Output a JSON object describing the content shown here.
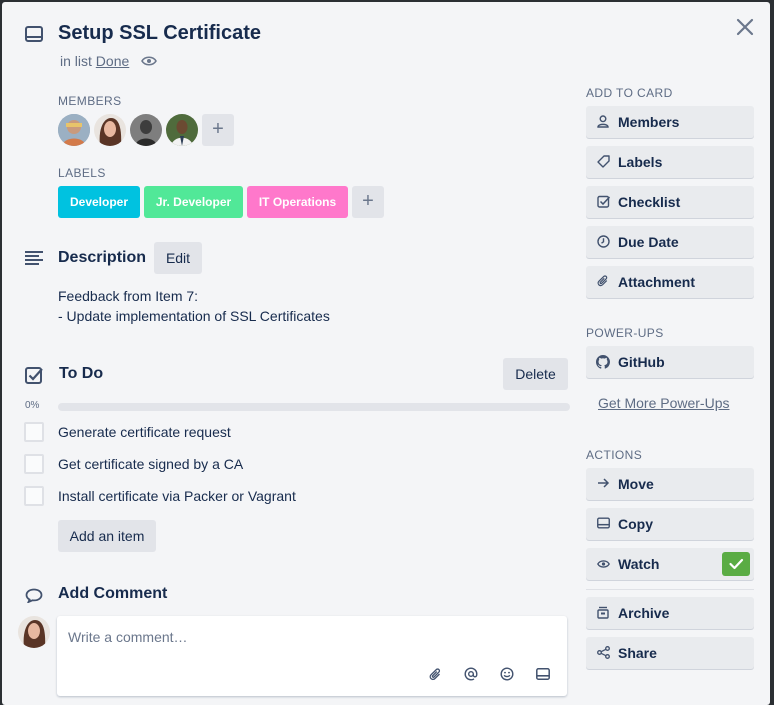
{
  "card": {
    "title": "Setup SSL Certificate",
    "in_list_prefix": "in list",
    "list_name": "Done"
  },
  "members": {
    "label": "MEMBERS",
    "avatars": [
      "member-1",
      "member-2",
      "member-3",
      "member-4"
    ],
    "add": "+"
  },
  "labels": {
    "label": "LABELS",
    "items": [
      {
        "text": "Developer",
        "color": "#00c2e0"
      },
      {
        "text": "Jr. Developer",
        "color": "#51e898"
      },
      {
        "text": "IT Operations",
        "color": "#ff78cb"
      }
    ],
    "add": "+"
  },
  "description": {
    "heading": "Description",
    "edit_label": "Edit",
    "line1": "Feedback from Item 7:",
    "line2": "- Update implementation of SSL Certificates"
  },
  "checklist": {
    "heading": "To Do",
    "delete_label": "Delete",
    "progress_text": "0%",
    "progress": 0,
    "items": [
      {
        "text": "Generate certificate request",
        "checked": false
      },
      {
        "text": "Get certificate signed by a CA",
        "checked": false
      },
      {
        "text": "Install certificate via Packer or Vagrant",
        "checked": false
      }
    ],
    "add_item_label": "Add an item"
  },
  "comment": {
    "heading": "Add Comment",
    "placeholder": "Write a comment…"
  },
  "sidebar": {
    "add_to_card_label": "ADD TO CARD",
    "add_to_card": [
      {
        "label": "Members",
        "icon": "person-icon"
      },
      {
        "label": "Labels",
        "icon": "tag-icon"
      },
      {
        "label": "Checklist",
        "icon": "checkbox-icon"
      },
      {
        "label": "Due Date",
        "icon": "clock-icon"
      },
      {
        "label": "Attachment",
        "icon": "paperclip-icon"
      }
    ],
    "powerups_label": "POWER-UPS",
    "github_label": "GitHub",
    "more_powerups": "Get More Power-Ups",
    "actions_label": "ACTIONS",
    "actions": [
      {
        "label": "Move",
        "icon": "arrow-right-icon"
      },
      {
        "label": "Copy",
        "icon": "card-icon"
      },
      {
        "label": "Watch",
        "icon": "eye-icon",
        "active": true
      },
      {
        "label": "Archive",
        "icon": "archive-icon"
      },
      {
        "label": "Share",
        "icon": "share-icon"
      }
    ],
    "watch_check_color": "#5aac44"
  },
  "colors": {
    "background": "#f4f5f7",
    "text": "#172b4d",
    "muted": "#5e6c84"
  }
}
